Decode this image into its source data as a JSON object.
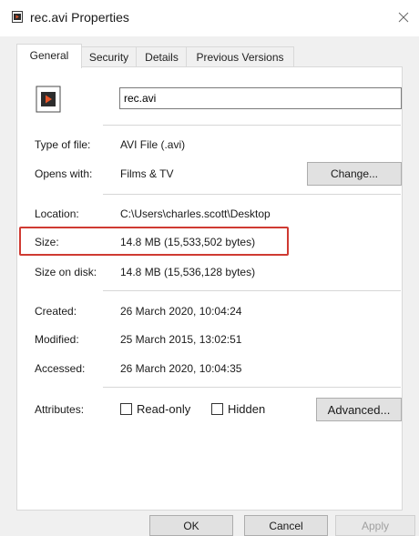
{
  "window": {
    "title": "rec.avi Properties",
    "close_icon": "close-icon"
  },
  "tabs": [
    {
      "label": "General",
      "active": true
    },
    {
      "label": "Security",
      "active": false
    },
    {
      "label": "Details",
      "active": false
    },
    {
      "label": "Previous Versions",
      "active": false
    }
  ],
  "general": {
    "file_name": "rec.avi",
    "file_icon": "video-file-icon",
    "type_label": "Type of file:",
    "type_value": "AVI File (.avi)",
    "opens_label": "Opens with:",
    "opens_value": "Films & TV",
    "change_button": "Change...",
    "location_label": "Location:",
    "location_value": "C:\\Users\\charles.scott\\Desktop",
    "size_label": "Size:",
    "size_value": "14.8 MB (15,533,502 bytes)",
    "size_on_disk_label": "Size on disk:",
    "size_on_disk_value": "14.8 MB (15,536,128 bytes)",
    "created_label": "Created:",
    "created_value": "26 March 2020, 10:04:24",
    "modified_label": "Modified:",
    "modified_value": "25 March 2015, 13:02:51",
    "accessed_label": "Accessed:",
    "accessed_value": "26 March 2020, 10:04:35",
    "attributes_label": "Attributes:",
    "readonly_label": "Read-only",
    "readonly_checked": false,
    "hidden_label": "Hidden",
    "hidden_checked": false,
    "advanced_button": "Advanced..."
  },
  "footer": {
    "ok": "OK",
    "cancel": "Cancel",
    "apply": "Apply"
  },
  "colors": {
    "highlight": "#cf3a32",
    "accent": "#0078d7"
  }
}
